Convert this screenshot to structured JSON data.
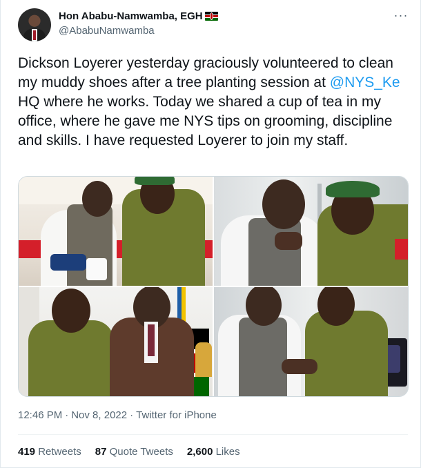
{
  "author": {
    "name": "Hon Ababu-Namwamba, EGH",
    "handle": "@AbabuNamwamba",
    "flag_icon": "kenya-flag-icon"
  },
  "tweet": {
    "text_1": "Dickson Loyerer yesterday graciously volunteered to clean my muddy shoes after a tree planting session at ",
    "mention": "@NYS_Ke",
    "text_2": " HQ where he works. Today we shared a cup of tea in my office, where he gave me NYS tips on grooming, discipline and skills. I have requested Loyerer to join my staff."
  },
  "meta": {
    "time": "12:46 PM",
    "separator": "·",
    "date": "Nov 8, 2022",
    "source": "Twitter for iPhone"
  },
  "stats": {
    "retweets_count": "419",
    "retweets_label": "Retweets",
    "quotes_count": "87",
    "quotes_label": "Quote Tweets",
    "likes_count": "2,600",
    "likes_label": "Likes"
  },
  "colors": {
    "link": "#1d9bf0",
    "secondary_text": "#536471",
    "primary_text": "#0f1419"
  }
}
